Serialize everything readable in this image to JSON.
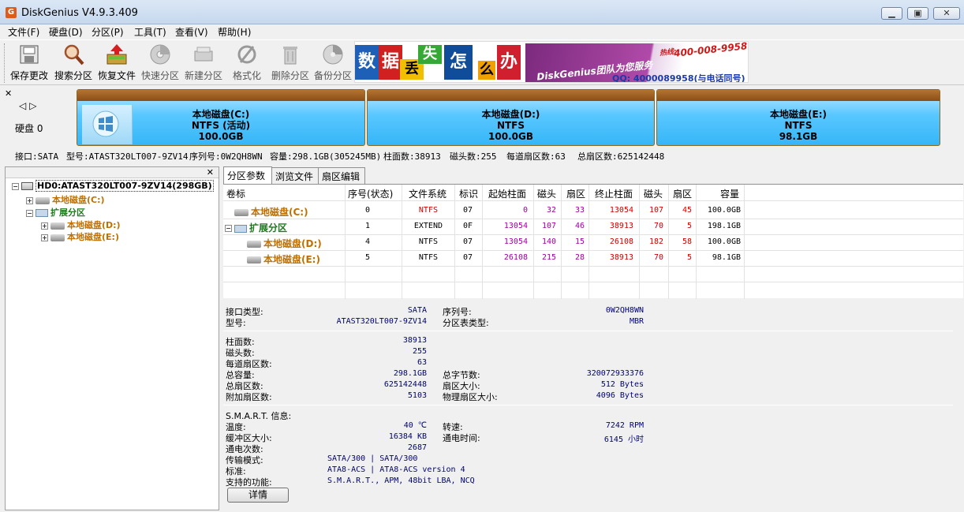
{
  "window": {
    "title": "DiskGenius V4.9.3.409",
    "app_icon": "G"
  },
  "menu": [
    "文件(F)",
    "硬盘(D)",
    "分区(P)",
    "工具(T)",
    "查看(V)",
    "帮助(H)"
  ],
  "toolbar": [
    {
      "label": "保存更改",
      "icon": "save-icon",
      "enabled": true
    },
    {
      "label": "搜索分区",
      "icon": "search-partition-icon",
      "enabled": true
    },
    {
      "label": "恢复文件",
      "icon": "recover-files-icon",
      "enabled": true
    },
    {
      "label": "快速分区",
      "icon": "quick-partition-icon",
      "enabled": false
    },
    {
      "label": "新建分区",
      "icon": "new-partition-icon",
      "enabled": false
    },
    {
      "label": "格式化",
      "icon": "format-icon",
      "enabled": false
    },
    {
      "label": "删除分区",
      "icon": "delete-partition-icon",
      "enabled": false
    },
    {
      "label": "备份分区",
      "icon": "backup-partition-icon",
      "enabled": false
    }
  ],
  "ad": {
    "tiles": [
      "数",
      "据",
      "丢",
      "失",
      "怎",
      "么",
      "办"
    ],
    "tile_colors": [
      "#1e5fb8",
      "#d02020",
      "#f0c000",
      "#36a836",
      "#0f4c9a",
      "#f0a000",
      "#d02030"
    ],
    "banner_text": "DiskGenius团队为您服务",
    "phone": "400-008-9958",
    "phone_label": "热线:",
    "qq": "QQ: 4000089958(与电话同号)"
  },
  "disk_map": {
    "disk_label": "硬盘 0",
    "partitions": [
      {
        "name": "本地磁盘(C:)",
        "fs": "NTFS (活动)",
        "size": "100.0GB"
      },
      {
        "name": "本地磁盘(D:)",
        "fs": "NTFS",
        "size": "100.0GB"
      },
      {
        "name": "本地磁盘(E:)",
        "fs": "NTFS",
        "size": "98.1GB"
      }
    ]
  },
  "disk_info": {
    "interface": "接口:SATA",
    "model": "型号:ATAST320LT007-9ZV14",
    "serial": "序列号:0W2QH8WN",
    "capacity": "容量:298.1GB(305245MB)",
    "cylinders": "柱面数:38913",
    "heads": "磁头数:255",
    "sectors_per_track": "每道扇区数:63",
    "total_sectors": "总扇区数:625142448"
  },
  "tree": {
    "disk": "HD0:ATAST320LT007-9ZV14(298GB)",
    "nodes": [
      {
        "label": "本地磁盘(C:)"
      },
      {
        "label": "扩展分区"
      },
      {
        "label": "本地磁盘(D:)"
      },
      {
        "label": "本地磁盘(E:)"
      }
    ]
  },
  "tabs": [
    "分区参数",
    "浏览文件",
    "扇区编辑"
  ],
  "table": {
    "headers": [
      "卷标",
      "序号(状态)",
      "文件系统",
      "标识",
      "起始柱面",
      "磁头",
      "扇区",
      "终止柱面",
      "磁头",
      "扇区",
      "容量"
    ],
    "rows": [
      {
        "name": "本地磁盘(C:)",
        "index": "0",
        "fs": "NTFS",
        "id": "07",
        "start_cyl": "0",
        "start_head": "32",
        "start_sec": "33",
        "end_cyl": "13054",
        "end_head": "107",
        "end_sec": "45",
        "size": "100.0GB"
      },
      {
        "name": "扩展分区",
        "index": "1",
        "fs": "EXTEND",
        "id": "0F",
        "start_cyl": "13054",
        "start_head": "107",
        "start_sec": "46",
        "end_cyl": "38913",
        "end_head": "70",
        "end_sec": "5",
        "size": "198.1GB"
      },
      {
        "name": "本地磁盘(D:)",
        "index": "4",
        "fs": "NTFS",
        "id": "07",
        "start_cyl": "13054",
        "start_head": "140",
        "start_sec": "15",
        "end_cyl": "26108",
        "end_head": "182",
        "end_sec": "58",
        "size": "100.0GB"
      },
      {
        "name": "本地磁盘(E:)",
        "index": "5",
        "fs": "NTFS",
        "id": "07",
        "start_cyl": "26108",
        "start_head": "215",
        "start_sec": "28",
        "end_cyl": "38913",
        "end_head": "70",
        "end_sec": "5",
        "size": "98.1GB"
      }
    ]
  },
  "details": {
    "interface_type_label": "接口类型:",
    "interface_type": "SATA",
    "serial_label": "序列号:",
    "serial": "0W2QH8WN",
    "model_label": "型号:",
    "model": "ATAST320LT007-9ZV14",
    "ptable_label": "分区表类型:",
    "ptable": "MBR",
    "cylinders_label": "柱面数:",
    "cylinders": "38913",
    "heads_label": "磁头数:",
    "heads": "255",
    "spt_label": "每道扇区数:",
    "spt": "63",
    "capacity_label": "总容量:",
    "capacity": "298.1GB",
    "total_bytes_label": "总字节数:",
    "total_bytes": "320072933376",
    "total_sectors_label": "总扇区数:",
    "total_sectors": "625142448",
    "sector_size_label": "扇区大小:",
    "sector_size": "512 Bytes",
    "extra_sectors_label": "附加扇区数:",
    "extra_sectors": "5103",
    "phys_sector_label": "物理扇区大小:",
    "phys_sector": "4096 Bytes",
    "smart_label": "S.M.A.R.T. 信息:",
    "temp_label": "温度:",
    "temp": "40 ℃",
    "speed_label": "转速:",
    "speed": "7242 RPM",
    "buffer_label": "缓冲区大小:",
    "buffer": "16384 KB",
    "power_time_label": "通电时间:",
    "power_time": "6145 小时",
    "power_count_label": "通电次数:",
    "power_count": "2687",
    "transfer_label": "传输模式:",
    "transfer": "SATA/300 | SATA/300",
    "standard_label": "标准:",
    "standard": "ATA8-ACS | ATA8-ACS version 4",
    "features_label": "支持的功能:",
    "features": "S.M.A.R.T., APM, 48bit LBA, NCQ",
    "button": "详情"
  }
}
